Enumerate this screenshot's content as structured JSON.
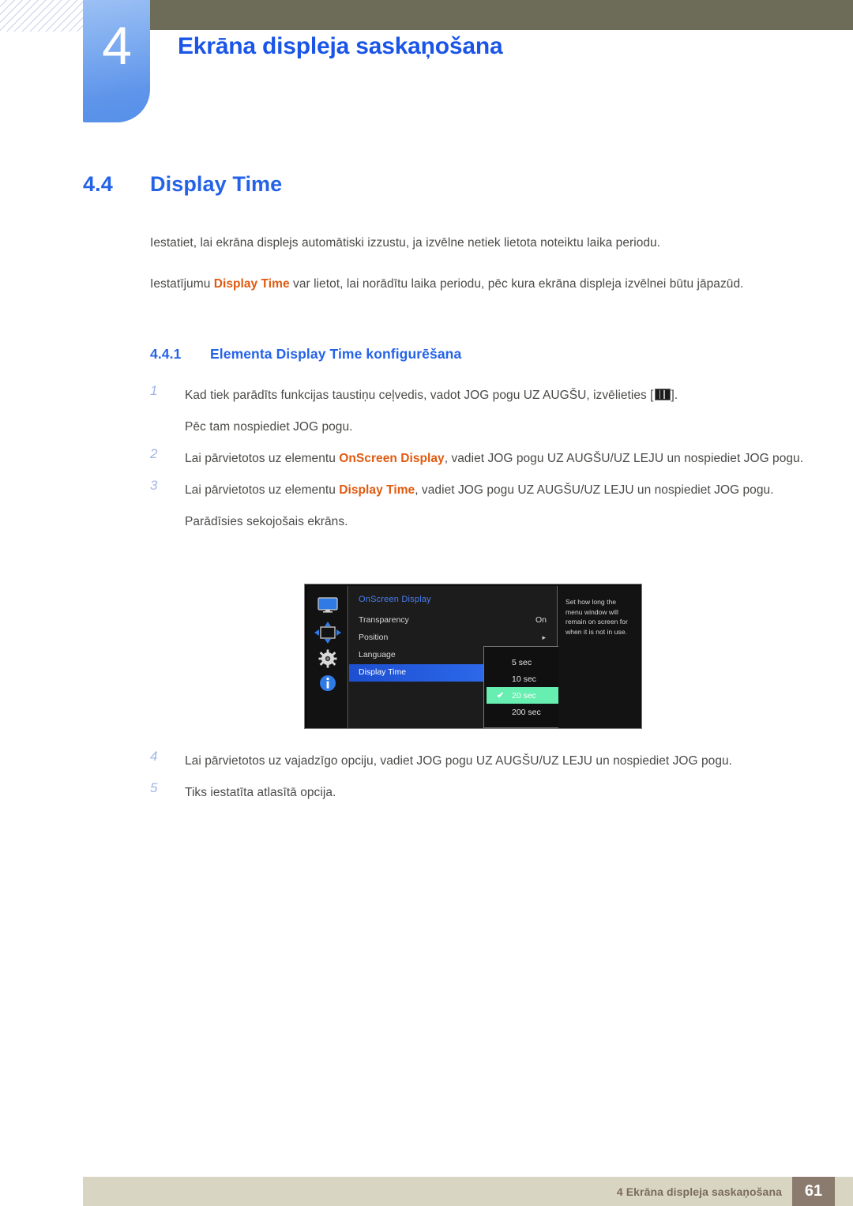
{
  "chapter": {
    "number": "4",
    "title": "Ekrāna displeja saskaņošana"
  },
  "section": {
    "number": "4.4",
    "title": "Display Time"
  },
  "paragraphs": {
    "p1": "Iestatiet, lai ekrāna displejs automātiski izzustu, ja izvēlne netiek lietota noteiktu laika periodu.",
    "p2_before": "Iestatījumu ",
    "p2_kw": "Display Time",
    "p2_after": " var lietot, lai norādītu laika periodu, pēc kura ekrāna displeja izvēlnei būtu jāpazūd."
  },
  "subsection": {
    "number": "4.4.1",
    "title": "Elementa Display Time konfigurēšana"
  },
  "steps": [
    {
      "num": "1",
      "text_before": "Kad tiek parādīts funkcijas taustiņu ceļvedis, vadot JOG pogu UZ AUGŠU, izvēlieties [",
      "icon": "osd-menu-icon",
      "text_after": "].",
      "sub": "Pēc tam nospiediet JOG pogu."
    },
    {
      "num": "2",
      "text_before": "Lai pārvietotos uz elementu ",
      "keyword": "OnScreen Display",
      "text_after": ", vadiet JOG pogu UZ AUGŠU/UZ LEJU un nospiediet JOG pogu.",
      "sub": ""
    },
    {
      "num": "3",
      "text_before": "Lai pārvietotos uz elementu ",
      "keyword": "Display Time",
      "text_after": ", vadiet JOG pogu UZ AUGŠU/UZ LEJU un nospiediet JOG pogu.",
      "sub": "Parādīsies sekojošais ekrāns."
    },
    {
      "num": "4",
      "text_before": "Lai pārvietotos uz vajadzīgo opciju, vadiet JOG pogu UZ AUGŠU/UZ LEJU un nospiediet JOG pogu.",
      "keyword": "",
      "text_after": "",
      "sub": ""
    },
    {
      "num": "5",
      "text_before": "Tiks iestatīta atlasītā opcija.",
      "keyword": "",
      "text_after": "",
      "sub": ""
    }
  ],
  "osd": {
    "heading": "OnScreen Display",
    "icons": [
      {
        "name": "monitor-icon"
      },
      {
        "name": "position-arrows-icon"
      },
      {
        "name": "gear-icon"
      },
      {
        "name": "info-icon"
      }
    ],
    "rows": [
      {
        "label": "Transparency",
        "value": "On",
        "arrow": ""
      },
      {
        "label": "Position",
        "value": "",
        "arrow": "▸"
      },
      {
        "label": "Language",
        "value": "",
        "arrow": ""
      },
      {
        "label": "Display Time",
        "value": "",
        "arrow": ""
      }
    ],
    "help_text": "Set how long the menu window will remain on screen for when it is not in use.",
    "dropdown": {
      "options": [
        "5 sec",
        "10 sec",
        "20 sec",
        "200 sec"
      ],
      "selected": "20 sec",
      "check_glyph": "✔"
    },
    "colors": {
      "highlight_blue": "#2a64e6",
      "selected_green": "#66efb0",
      "heading_blue": "#4a7ef0"
    }
  },
  "footer": {
    "text": "4 Ekrāna displeja saskaņošana",
    "page": "61"
  },
  "colors": {
    "heading_blue": "#2463e8",
    "keyword_orange": "#e05a10",
    "header_olive": "#6d6c58",
    "footer_beige": "#d9d5c3",
    "footer_page_brown": "#8a7b6e"
  }
}
